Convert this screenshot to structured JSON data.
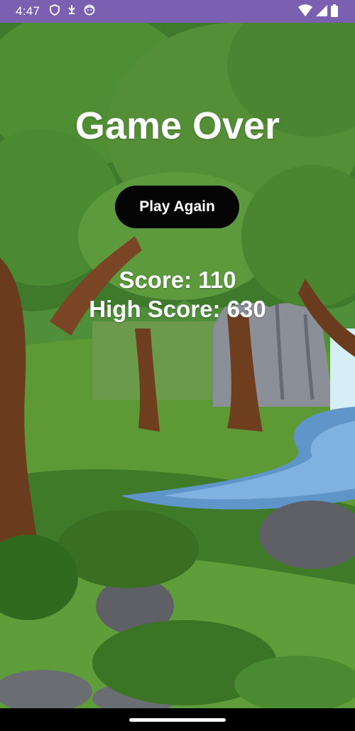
{
  "status_bar": {
    "time": "4:47",
    "icons": [
      "shield-icon",
      "usb-debug-icon",
      "face-icon",
      "wifi-icon",
      "cellular-signal-icon",
      "battery-icon"
    ]
  },
  "game_over": {
    "title": "Game Over",
    "play_again_label": "Play Again",
    "score_text": "Score: 110",
    "high_score_text": "High Score: 630"
  },
  "colors": {
    "status_bar": "#7b5fb0",
    "button_bg": "#050505",
    "text": "#ffffff"
  }
}
